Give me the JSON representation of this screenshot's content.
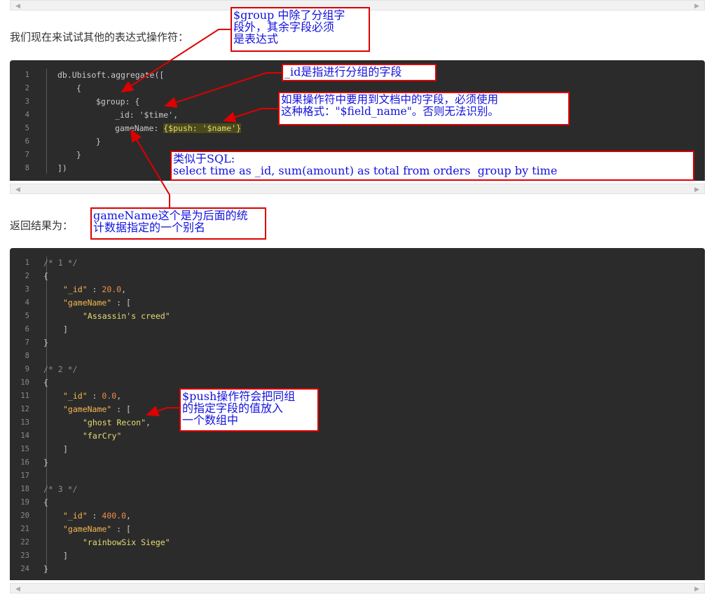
{
  "intro_text": "我们现在来试试其他的表达式操作符：",
  "result_text": "返回结果为：",
  "scroll_left": "◀",
  "scroll_right": "▶",
  "code1": {
    "line_numbers": [
      "1",
      "2",
      "3",
      "4",
      "5",
      "6",
      "7",
      "8"
    ],
    "l1": "db.Ubisoft.aggregate([",
    "l2": "{",
    "l3": "$group: {",
    "l4a": "_id: ",
    "l4b": "'$time'",
    "l4c": ",",
    "l5a": "gameName: ",
    "l5b": "{$push: '$name'}",
    "l6": "}",
    "l7": "}",
    "l8": "])"
  },
  "code2": {
    "line_numbers": [
      "1",
      "2",
      "3",
      "4",
      "5",
      "6",
      "7",
      "8",
      "9",
      "10",
      "11",
      "12",
      "13",
      "14",
      "15",
      "16",
      "17",
      "18",
      "19",
      "20",
      "21",
      "22",
      "23",
      "24"
    ],
    "c1": "/* 1 */",
    "c2": "{",
    "c3k": "\"_id\"",
    "c3v": "20.0",
    "c4k": "\"gameName\"",
    "c5": "\"Assassin's creed\"",
    "c6": "]",
    "c7": "}",
    "c9": "/* 2 */",
    "c10": "{",
    "c11k": "\"_id\"",
    "c11v": "0.0",
    "c12k": "\"gameName\"",
    "c13": "\"ghost Recon\"",
    "c14": "\"farCry\"",
    "c15": "]",
    "c16": "}",
    "c18": "/* 3 */",
    "c19": "{",
    "c20k": "\"_id\"",
    "c20v": "400.0",
    "c21k": "\"gameName\"",
    "c22": "\"rainbowSix Siege\"",
    "c23": "]",
    "c24": "}"
  },
  "annotations": {
    "group_note": "$group 中除了分组字\n段外，其余字段必须\n是表达式",
    "id_note": "_id是指进行分组的字段",
    "field_note": "如果操作符中要用到文档中的字段，必须使用\n这种格式：\"$field_name\"。否则无法识别。",
    "sql_note": "类似于SQL:\nselect time as _id, sum(amount) as total from orders  group by time",
    "alias_note": "gameName这个是为后面的统\n计数据指定的一个别名",
    "push_note": "$push操作符会把同组\n的指定字段的值放入\n一个数组中"
  },
  "colors": {
    "annotation_border": "#dd0000",
    "annotation_text": "#1212dd",
    "code_bg": "#2b2b2b"
  }
}
